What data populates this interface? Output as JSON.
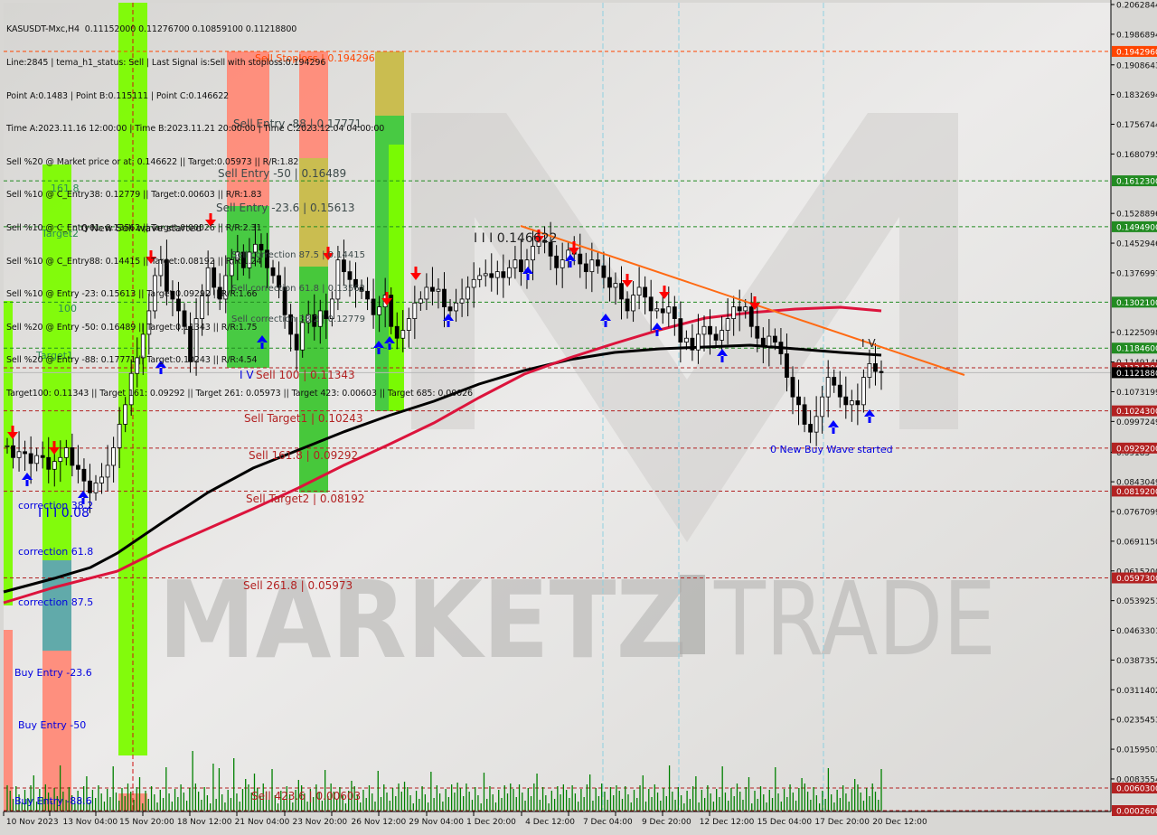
{
  "header": {
    "symbol_line": "KASUSDT-Mxc,H4  0.11152000 0.11276700 0.10859100 0.11218800",
    "info_lines": [
      "Line:2845 | tema_h1_status: Sell | Last Signal is:Sell with stoploss:0.194296",
      "Point A:0.1483 | Point B:0.115111 | Point C:0.146622",
      "Time A:2023.11.16 12:00:00 | Time B:2023.11.21 20:00:00 | Time C:2023.12.04 04:00:00",
      "Sell %20 @ Market price or at: 0.146622 || Target:0.05973 || R/R:1.82",
      "Sell %10 @ C_Entry38: 0.12779 || Target:0.00603 || R/R:1.83",
      "Sell %10 @ C_Entry61: 0.13562 || Target:0.00026 || R/R:2.31",
      "Sell %10 @ C_Entry88: 0.14415 || Target:0.08192 || R/R:1.24",
      "Sell %10 @ Entry -23: 0.15613 || Target:0.09292 || R/R:1.66",
      "Sell %20 @ Entry -50: 0.16489 || Target:0.11343 || R/R:1.75",
      "Sell %20 @ Entry -88: 0.17771 || Target:0.10243 || R/R:4.54",
      "Target100: 0.11343 || Target 161: 0.09292 || Target 261: 0.05973 || Target 423: 0.00603 || Target 685: 0.00026"
    ]
  },
  "watermark": {
    "left": "MARKETZ",
    "right": "TRADE"
  },
  "colors": {
    "background": "#d8d7d4",
    "bull_candle": "#ffffff",
    "bear_candle": "#000000",
    "ma_slow": "#000000",
    "ma_fast": "#dc143c",
    "trendline": "#ff6a13",
    "sell_level": "#b22222",
    "buy_level": "#228b22",
    "stoploss": "#ff4500",
    "volume": "#008000",
    "sell_arrow": "#ff0000",
    "buy_arrow": "#0000ff",
    "bright_green": "#7cfc00",
    "mid_green": "#3fc83a",
    "salmon": "#ff8a78",
    "olive": "#c8bb48",
    "teal": "#5aa6a6"
  },
  "chart_data": {
    "type": "candlestick",
    "title": "KASUSDT-Mxc,H4",
    "ohlc_current": {
      "open": 0.11152,
      "high": 0.112767,
      "low": 0.108591,
      "close": 0.112188
    },
    "ylim": [
      0.00026,
      0.2062844
    ],
    "grid": false,
    "y_ticks": [
      "0.20628440",
      "0.19868945",
      "0.19086435",
      "0.18326940",
      "0.17567445",
      "0.16807950",
      "0.15288960",
      "0.14529465",
      "0.13769970",
      "0.12250980",
      "0.11491485",
      "0.10731990",
      "0.09972495",
      "0.09185",
      "0.08430490",
      "0.07670995",
      "0.06911500",
      "0.06152005",
      "0.05392510",
      "0.04633015",
      "0.03873520",
      "0.03114025",
      "0.02354530",
      "0.01595035",
      "0.00835540"
    ],
    "y_tick_values": [
      0.2062844,
      0.19868945,
      0.19086435,
      0.1832694,
      0.17567445,
      0.1680795,
      0.1528896,
      0.14529465,
      0.1376997,
      0.1225098,
      0.11491485,
      0.1073199,
      0.09972495,
      0.09185,
      0.0843049,
      0.07670995,
      0.069115,
      0.06152005,
      0.0539251,
      0.04633015,
      0.0387352,
      0.03114025,
      0.0235453,
      0.01595035,
      0.0083554
    ],
    "x_tick_labels": [
      "10 Nov 2023",
      "13 Nov 04:00",
      "15 Nov 20:00",
      "18 Nov 12:00",
      "21 Nov 04:00",
      "23 Nov 20:00",
      "26 Nov 12:00",
      "29 Nov 04:00",
      "1 Dec 20:00",
      "4 Dec 12:00",
      "7 Dec 04:00",
      "9 Dec 20:00",
      "12 Dec 12:00",
      "15 Dec 04:00",
      "17 Dec 20:00",
      "20 Dec 12:00"
    ],
    "price_tags": [
      {
        "value": 0.194296,
        "label": "0.19429600",
        "kind": "stoploss"
      },
      {
        "value": 0.16123,
        "label": "0.16123000",
        "kind": "buy"
      },
      {
        "value": 0.14949,
        "label": "0.14949000",
        "kind": "buy"
      },
      {
        "value": 0.13021,
        "label": "0.13021000",
        "kind": "buy"
      },
      {
        "value": 0.11846,
        "label": "0.11846000",
        "kind": "buy"
      },
      {
        "value": 0.11343,
        "label": "0.11343000",
        "kind": "sell"
      },
      {
        "value": 0.112188,
        "label": "0.11218800",
        "kind": "current"
      },
      {
        "value": 0.10243,
        "label": "0.10243000",
        "kind": "sell"
      },
      {
        "value": 0.09292,
        "label": "0.09292000",
        "kind": "sell"
      },
      {
        "value": 0.08192,
        "label": "0.08192000",
        "kind": "sell"
      },
      {
        "value": 0.05973,
        "label": "0.05973000",
        "kind": "sell"
      },
      {
        "value": 0.00603,
        "label": "0.00603000",
        "kind": "sell"
      },
      {
        "value": 0.00026,
        "label": "0.00026000",
        "kind": "sell"
      }
    ],
    "level_labels": [
      {
        "text": "Sell Stoploss | 0.194296",
        "value": 0.194296,
        "kind": "stoploss"
      },
      {
        "text": "Sell Entry -88 | 0.17771",
        "value": 0.17771,
        "kind": "entry"
      },
      {
        "text": "Sell Entry -50 | 0.16489",
        "value": 0.16489,
        "kind": "entry"
      },
      {
        "text": "Sell Entry -23.6 | 0.15613",
        "value": 0.15613,
        "kind": "entry"
      },
      {
        "text": "Sell correction 87.5 | 0.14415",
        "value": 0.14415,
        "kind": "entry"
      },
      {
        "text": "Sell correction 61.8 | 0.13562",
        "value": 0.13562,
        "kind": "entry"
      },
      {
        "text": "Sell correction 38.2 | 0.12779",
        "value": 0.12779,
        "kind": "entry"
      },
      {
        "text": "Sell 100 | 0.11343",
        "value": 0.11343,
        "kind": "sell"
      },
      {
        "text": "Sell Target1 | 0.10243",
        "value": 0.10243,
        "kind": "sell"
      },
      {
        "text": "Sell 161.8 | 0.09292",
        "value": 0.09292,
        "kind": "sell"
      },
      {
        "text": "Sell Target2 | 0.08192",
        "value": 0.08192,
        "kind": "sell"
      },
      {
        "text": "Sell  261.8 | 0.05973",
        "value": 0.05973,
        "kind": "sell"
      },
      {
        "text": "Sell  423.6 | 0.00603",
        "value": 0.00603,
        "kind": "sell"
      }
    ],
    "buy_labels": [
      {
        "text": "161.8",
        "kind": "green"
      },
      {
        "text": "Target2",
        "kind": "green"
      },
      {
        "text": "100",
        "kind": "green"
      },
      {
        "text": "Target1",
        "kind": "green"
      },
      {
        "text": "correction 38.2",
        "kind": "blue"
      },
      {
        "text": "correction 61.8",
        "kind": "blue"
      },
      {
        "text": "correction 87.5",
        "kind": "blue"
      },
      {
        "text": "Buy Entry -23.6",
        "kind": "blue"
      },
      {
        "text": "Buy Entry -50",
        "kind": "blue"
      },
      {
        "text": "Buy Entry -88.6",
        "kind": "blue"
      }
    ],
    "annotations": [
      {
        "text": "0 New Sell wave started"
      },
      {
        "text": "0 New Buy Wave started"
      },
      {
        "text": "I I I 0.146622"
      },
      {
        "text": "I I I 0.08"
      },
      {
        "text": "I V"
      },
      {
        "text": "I V"
      }
    ],
    "points": {
      "A": 0.1483,
      "B": 0.115111,
      "C": 0.146622
    },
    "trendline": {
      "start": {
        "x_index": 0.472,
        "value": 0.1483
      },
      "end": {
        "x_index": 0.878,
        "value": 0.1141
      }
    },
    "series_close": [
      0.0935,
      0.0905,
      0.092,
      0.0915,
      0.089,
      0.091,
      0.0905,
      0.0875,
      0.0895,
      0.0905,
      0.093,
      0.0885,
      0.0875,
      0.0845,
      0.0815,
      0.084,
      0.0855,
      0.0885,
      0.093,
      0.099,
      0.104,
      0.112,
      0.116,
      0.122,
      0.128,
      0.137,
      0.141,
      0.133,
      0.131,
      0.128,
      0.124,
      0.115,
      0.126,
      0.132,
      0.139,
      0.134,
      0.131,
      0.137,
      0.141,
      0.143,
      0.139,
      0.143,
      0.145,
      0.1435,
      0.139,
      0.137,
      0.134,
      0.127,
      0.122,
      0.118,
      0.125,
      0.127,
      0.124,
      0.128,
      0.126,
      0.131,
      0.141,
      0.138,
      0.136,
      0.134,
      0.133,
      0.131,
      0.127,
      0.129,
      0.132,
      0.124,
      0.121,
      0.123,
      0.126,
      0.13,
      0.131,
      0.134,
      0.133,
      0.1335,
      0.129,
      0.128,
      0.13,
      0.131,
      0.134,
      0.136,
      0.137,
      0.1375,
      0.1365,
      0.138,
      0.1365,
      0.139,
      0.141,
      0.138,
      0.141,
      0.1445,
      0.146,
      0.1455,
      0.142,
      0.139,
      0.141,
      0.1435,
      0.1425,
      0.14,
      0.138,
      0.141,
      0.1395,
      0.1365,
      0.134,
      0.135,
      0.131,
      0.128,
      0.132,
      0.134,
      0.1315,
      0.128,
      0.1285,
      0.1275,
      0.129,
      0.126,
      0.12,
      0.121,
      0.118,
      0.122,
      0.124,
      0.122,
      0.1205,
      0.123,
      0.126,
      0.129,
      0.128,
      0.129,
      0.124,
      0.121,
      0.119,
      0.1215,
      0.12,
      0.117,
      0.111,
      0.106,
      0.104,
      0.099,
      0.097,
      0.101,
      0.106,
      0.111,
      0.109,
      0.106,
      0.104,
      0.105,
      0.104,
      0.111,
      0.1145,
      0.1125,
      0.1122
    ]
  }
}
